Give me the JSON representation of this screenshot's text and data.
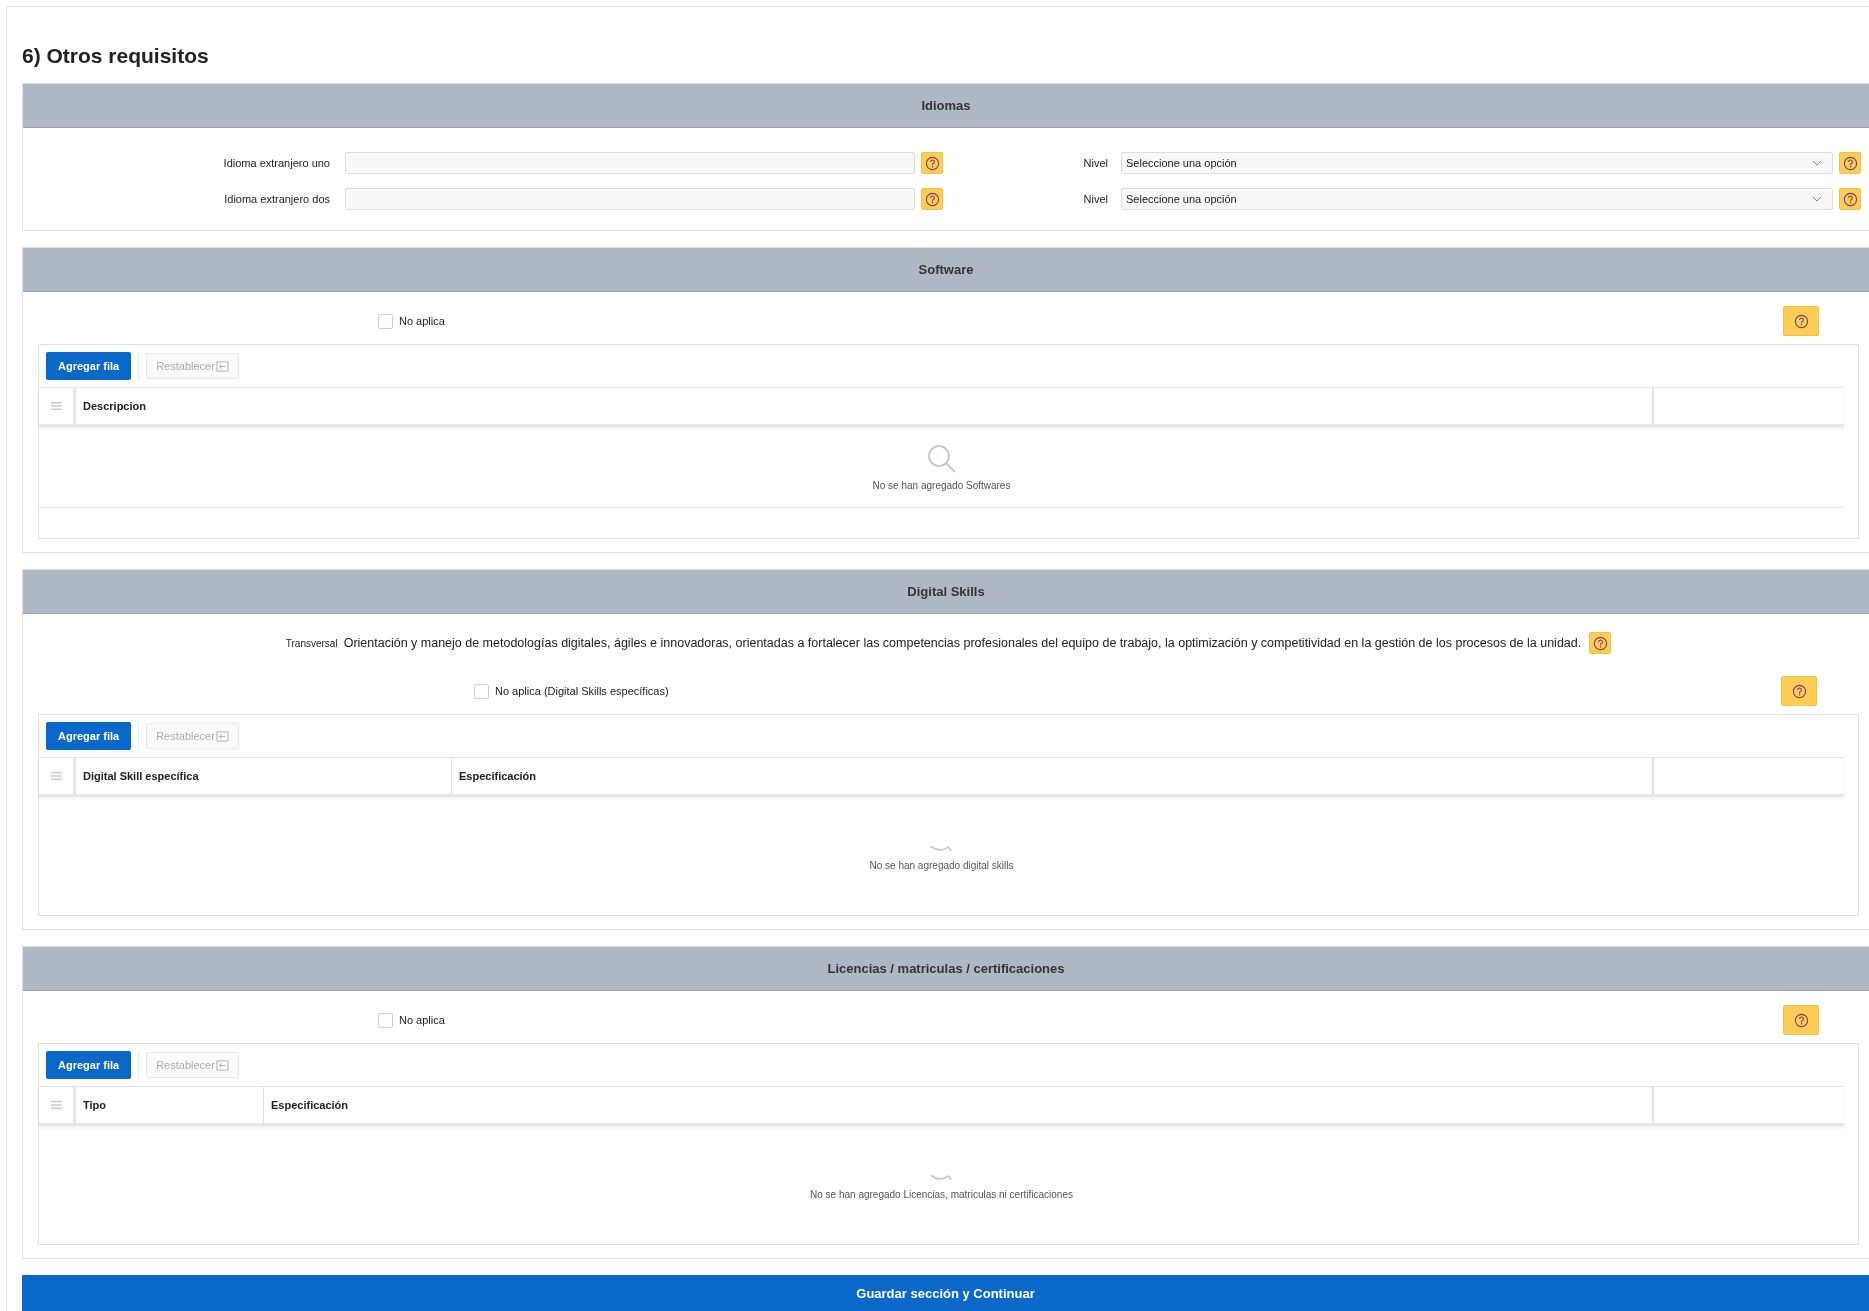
{
  "title": "6) Otros requisitos",
  "sections": [
    {
      "kind": "languages",
      "title": "Idiomas",
      "rows": [
        {
          "label": "Idioma extranjero uno",
          "level_label": "Nivel",
          "level_placeholder": "Seleccione una opción"
        },
        {
          "label": "Idioma extranjero dos",
          "level_label": "Nivel",
          "level_placeholder": "Seleccione una opción"
        }
      ]
    },
    {
      "kind": "grid",
      "title": "Software",
      "not_applicable": {
        "label": "No aplica",
        "checked": false
      },
      "add_button": "Agregar fila",
      "reset_button": {
        "label": "Restablecer",
        "disabled": true
      },
      "columns": [
        "Descripcion"
      ],
      "empty_state": {
        "kind": "magnifier",
        "text": "No se han agregado Softwares"
      },
      "footer_bar": true
    },
    {
      "kind": "grid",
      "title": "Digital Skills",
      "transversal": {
        "label": "Transversal",
        "text": "Orientación y manejo de metodologías digitales, ágiles e innovadoras, orientadas a fortalecer las competencias profesionales del equipo de trabajo, la optimización y competitividad en la gestión de los procesos de la unidad."
      },
      "not_applicable": {
        "label": "No aplica (Digital Skills específicas)",
        "checked": false
      },
      "add_button": "Agregar fila",
      "reset_button": {
        "label": "Restablecer",
        "disabled": true
      },
      "columns": [
        "Digital Skill específica",
        "Especificación"
      ],
      "empty_state": {
        "kind": "arc",
        "text": "No se han agregado digital skills"
      },
      "footer_bar": false
    },
    {
      "kind": "grid",
      "title": "Licencias / matriculas / certificaciones",
      "not_applicable": {
        "label": "No aplica",
        "checked": false
      },
      "add_button": "Agregar fila",
      "reset_button": {
        "label": "Restablecer",
        "disabled": true
      },
      "columns": [
        "Tipo",
        "Especificación"
      ],
      "empty_state": {
        "kind": "arc",
        "text": "No se han agregado Licencias, matriculas ni certificaciones"
      },
      "footer_bar": false
    }
  ],
  "save_button": "Guardar sección y Continuar"
}
